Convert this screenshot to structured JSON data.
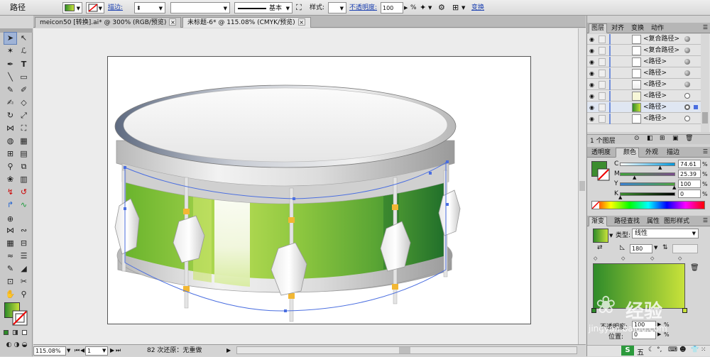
{
  "control_bar": {
    "object_type": "路径",
    "stroke_label": "描边:",
    "stroke_profile": "基本",
    "style_label": "样式:",
    "opacity_label": "不透明度:",
    "opacity_value": "100",
    "opacity_unit": "%",
    "transform_label": "变换",
    "fill_color": "#5aa534",
    "icons": {
      "fill_swatch_arrow": "chevron-down-icon",
      "stroke_none": "no-stroke-icon",
      "align": "align-icon",
      "recolor": "recolor-icon",
      "transform": "transform-icon"
    }
  },
  "document_tabs": [
    {
      "label": "meicon50 [转换].ai* @ 300% (RGB/预览)",
      "close": "×"
    },
    {
      "label": "未标题-6* @ 115.08% (CMYK/预览)",
      "close": "×"
    }
  ],
  "status_bar": {
    "zoom": "115.08%",
    "artboard_number": "1",
    "status_text": "82 次还原：无重做"
  },
  "layers_panel": {
    "tabs": [
      "图层",
      "对齐",
      "变换",
      "动作"
    ],
    "rows": [
      {
        "name": "<复合路径>",
        "thumb": "#f4f4f4",
        "target": "#666"
      },
      {
        "name": "<复合路径>",
        "thumb": "#f4f4f4",
        "target": "#666"
      },
      {
        "name": "<路径>",
        "thumb": "#ffffff",
        "target": "#666"
      },
      {
        "name": "<路径>",
        "thumb": "#ffffff",
        "target": "#666"
      },
      {
        "name": "<路径>",
        "thumb": "#ffffff",
        "target": "#666"
      },
      {
        "name": "<路径>",
        "thumb": "#ffffff",
        "target": "#ffffff"
      },
      {
        "name": "<路径>",
        "thumb": "#8cc63f",
        "target": "#ffffff"
      },
      {
        "name": "<路径>",
        "thumb": "#ffffff",
        "target": "#ffffff"
      }
    ],
    "footer": "1 个图层"
  },
  "color_panel": {
    "tabs": [
      "透明度",
      "颜色",
      "外观",
      "描边"
    ],
    "active_fill": "#3c8d2f",
    "channels": [
      {
        "label": "C",
        "value": "74.61",
        "unit": "%",
        "level": 0.7461,
        "gradient": "linear-gradient(90deg,#ffffff,#0099dd)"
      },
      {
        "label": "M",
        "value": "25.39",
        "unit": "%",
        "level": 0.2539,
        "gradient": "linear-gradient(90deg,#3fa33a,#7a4a8c)"
      },
      {
        "label": "Y",
        "value": "100",
        "unit": "%",
        "level": 1.0,
        "gradient": "linear-gradient(90deg,#3c7fd0,#4ea33a)"
      },
      {
        "label": "K",
        "value": "0",
        "unit": "%",
        "level": 0.0,
        "gradient": "linear-gradient(90deg,#3c8d2f,#000000)"
      }
    ]
  },
  "gradient_panel": {
    "tabs": [
      "渐变",
      "路径查找",
      "属性",
      "图形样式"
    ],
    "type_label": "类型:",
    "type_value": "线性",
    "angle_value": "180",
    "opacity_label": "不透明度:",
    "opacity_value": "100",
    "location_label": "位置:",
    "location_value": "0",
    "start_color": "#2f8b2a",
    "end_color": "#c8e23a"
  },
  "watermark": {
    "text": "经验",
    "subtext": "jingyan.baidu.com"
  },
  "taskbar": {
    "ime_label": "五"
  }
}
